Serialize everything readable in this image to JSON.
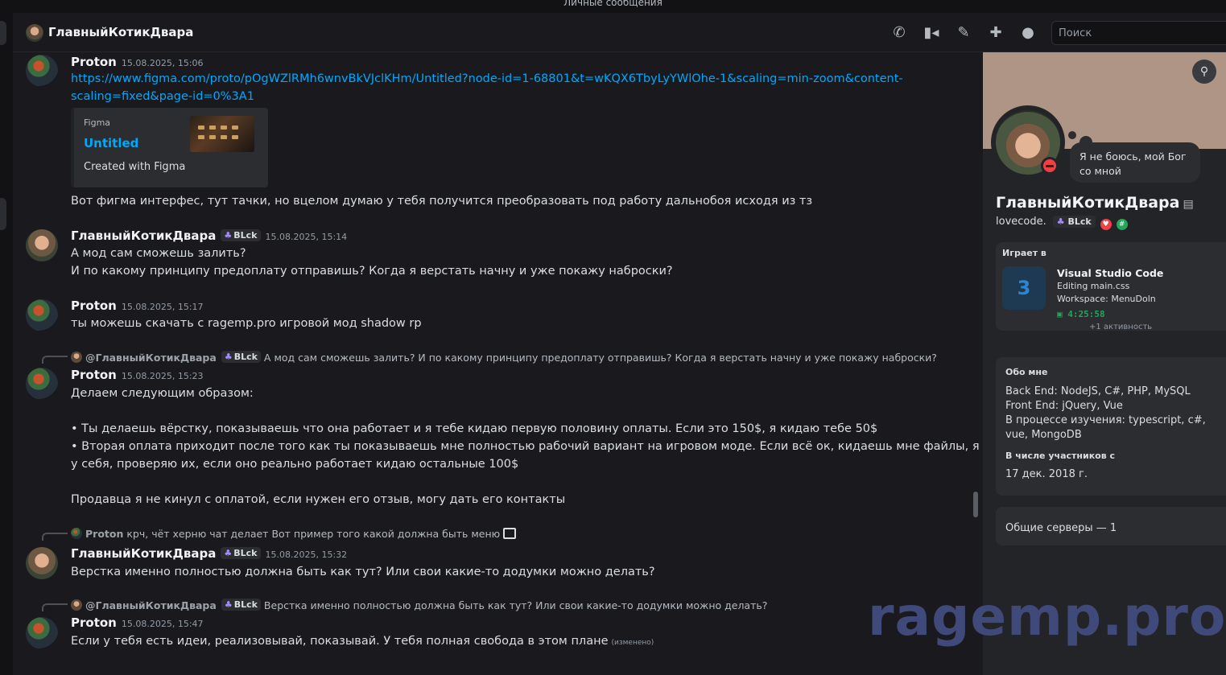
{
  "topbar": {
    "label": "Личные сообщения"
  },
  "header": {
    "title": "ГлавныйКотикДвара",
    "search_placeholder": "Поиск"
  },
  "messages": [
    {
      "author": "Proton",
      "time": "15.08.2025, 15:06",
      "link_line1": "https://www.figma.com/proto/pOgWZlRMh6wnvBkVJclKHm/Untitled?node-id=1-68801&t=wKQX6TbyLyYWlOhe-1&scaling=min-zoom&content-",
      "link_line2": "scaling=fixed&page-id=0%3A1",
      "embed": {
        "provider": "Figma",
        "title": "Untitled",
        "description": "Created with Figma"
      },
      "text": "Вот фигма интерфес, тут тачки, но вцелом думаю у тебя получится преобразовать под работу дальнобоя исходя из тз"
    },
    {
      "author": "ГлавныйКотикДвара",
      "tag": "BLck",
      "time": "15.08.2025, 15:14",
      "line1": "А мод сам сможешь залить?",
      "line2": "И по какому принципу предоплату отправишь? Когда я верстать начну и уже покажу наброски?"
    },
    {
      "author": "Proton",
      "time": "15.08.2025, 15:17",
      "text": "ты можешь скачать с ragemp.pro игровой мод shadow rp"
    },
    {
      "reply_to": "@ГлавныйКотикДвара",
      "reply_tag": "BLck",
      "reply_text": "А мод сам сможешь залить? И по какому принципу предоплату отправишь? Когда я верстать начну и уже покажу наброски?",
      "author": "Proton",
      "time": "15.08.2025, 15:23",
      "line1": "Делаем следующим образом:",
      "line2": "• Ты делаешь вёрстку, показываешь что она работает и я тебе кидаю первую половину оплаты. Если это 150$, я кидаю тебе 50$",
      "line3": "• Вторая оплата приходит после того как ты показываешь мне полностью рабочий вариант на игровом моде. Если всё ок, кидаешь мне файлы, я запускаю",
      "line4": "у себя, проверяю их, если оно реально работает кидаю остальные 100$",
      "line5": "Продавца я не кинул с оплатой, если нужен его отзыв, могу дать его контакты"
    },
    {
      "reply_to": "Proton",
      "reply_text": "крч, чёт херню чат делает  Вот пример того какой должна быть меню",
      "author": "ГлавныйКотикДвара",
      "tag": "BLck",
      "time": "15.08.2025, 15:32",
      "text": "Верстка именно полностью должна быть как тут? Или свои какие-то додумки можно делать?"
    },
    {
      "reply_to": "@ГлавныйКотикДвара",
      "reply_tag": "BLck",
      "reply_text": "Верстка именно полностью должна быть как тут? Или свои какие-то додумки можно делать?",
      "author": "Proton",
      "time": "15.08.2025, 15:47",
      "text": "Если у тебя есть идеи, реализовывай, показывай. У тебя полная свобода в этом плане",
      "edited": "(изменено)"
    }
  ],
  "profile": {
    "status_bubble": "Я не боюсь, мой Бог со мной",
    "name": "ГлавныйКотикДвара",
    "username": "lovecode.",
    "tag": "BLck",
    "activity": {
      "label": "Играет в",
      "app": "Visual Studio Code",
      "details": "Editing main.css",
      "state": "Workspace: MenuDoln",
      "elapsed": "4:25:58",
      "more": "+1 активность"
    },
    "about": {
      "label": "Обо мне",
      "l1": "Back End: NodeJS, C#, PHP, MySQL",
      "l2": "Front End: jQuery, Vue",
      "l3": "В процессе изучения: typescript, c#, vue, MongoDB"
    },
    "member_since": {
      "label": "В числе участников с",
      "date": "17 дек. 2018 г."
    },
    "mutual": "Общие серверы — 1"
  },
  "watermark": "ragemp.pro",
  "colors": {
    "accent_link": "#00a8fc",
    "dnd": "#f23f43",
    "background": "#1a1a1e",
    "panel": "#232428"
  }
}
